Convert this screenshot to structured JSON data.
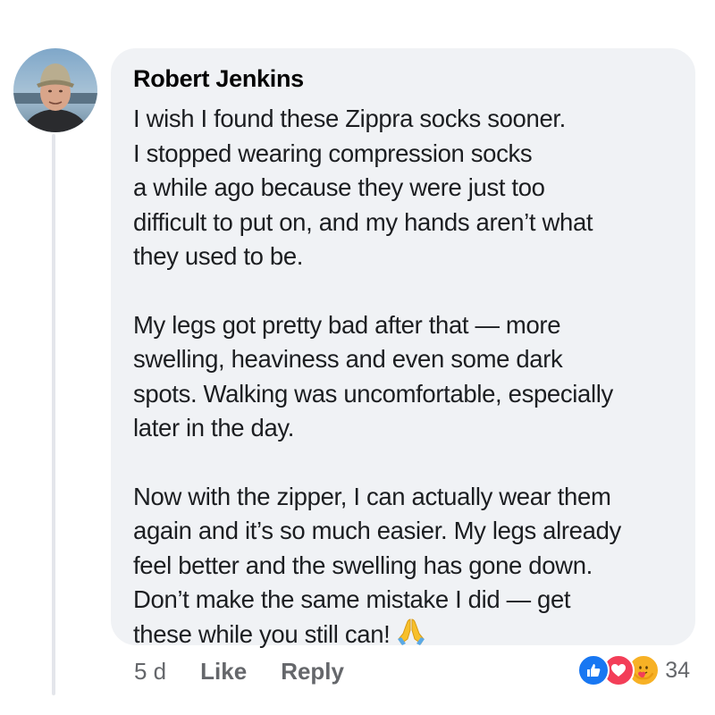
{
  "comment": {
    "author": "Robert Jenkins",
    "paragraphs": [
      [
        "I wish I found these Zippra socks sooner.",
        "I stopped wearing compression socks",
        "a while ago because they were just too",
        "difficult to put on, and my hands aren’t what",
        "they used to be."
      ],
      [
        "My legs got pretty bad after that — more",
        "swelling, heaviness and even some dark",
        "spots. Walking was uncomfortable, especially",
        "later in the day."
      ],
      [
        "Now with the zipper, I can actually wear them",
        "again and it’s so much easier. My legs already",
        "feel better and the swelling has gone down.",
        "Don’t make the same mistake I did — get",
        "these while you still can!"
      ]
    ],
    "trailing_emoji": "folded-hands-emoji",
    "time": "5 d",
    "like_label": "Like",
    "reply_label": "Reply",
    "reactions": {
      "icons": [
        "like-icon",
        "love-icon",
        "care-icon"
      ],
      "count": "34"
    }
  },
  "colors": {
    "bubble": "#f0f2f5",
    "like": "#1877f2",
    "love": "#f33e58",
    "care": "#f7b125",
    "muted": "#65676b"
  }
}
